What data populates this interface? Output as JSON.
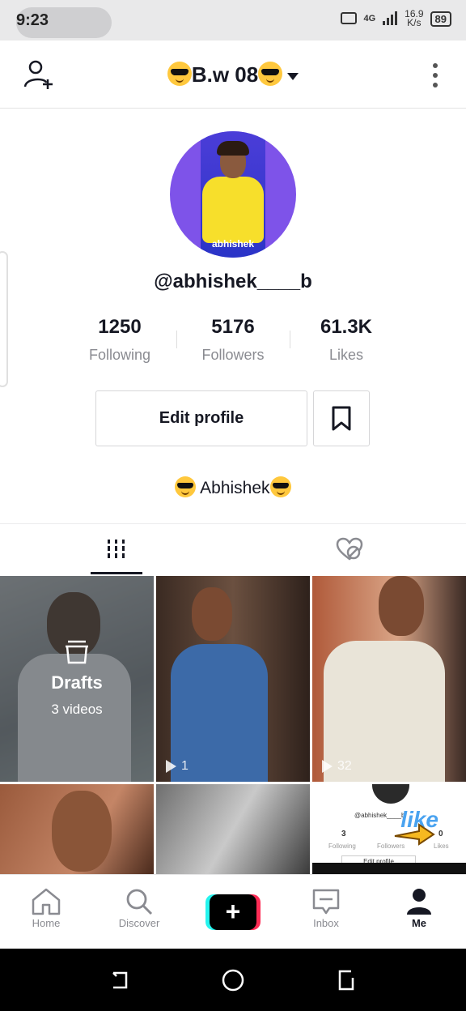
{
  "status_bar": {
    "time": "9:23",
    "network": "4G",
    "speed": "16.9",
    "speed_unit": "K/s",
    "battery": "89"
  },
  "header": {
    "title": "B.w 08"
  },
  "profile": {
    "avatar_caption": "abhishek",
    "handle": "@abhishek____b",
    "stats": [
      {
        "value": "1250",
        "label": "Following"
      },
      {
        "value": "5176",
        "label": "Followers"
      },
      {
        "value": "61.3K",
        "label": "Likes"
      }
    ],
    "edit_label": "Edit profile",
    "bio": "Abhishek"
  },
  "grid": {
    "drafts_title": "Drafts",
    "drafts_count": "3 videos",
    "views": [
      "1",
      "32"
    ],
    "thumb6": {
      "handle": "@abhishek____b",
      "following_num": "3",
      "following_label": "Following",
      "followers_label": "Followers",
      "likes_num": "0",
      "likes_label": "Likes",
      "edit_label": "Edit profile",
      "overlay": "like"
    }
  },
  "bottom_nav": [
    {
      "label": "Home",
      "icon": "home-icon"
    },
    {
      "label": "Discover",
      "icon": "search-icon"
    },
    {
      "label": "",
      "icon": "plus-icon"
    },
    {
      "label": "Inbox",
      "icon": "inbox-icon"
    },
    {
      "label": "Me",
      "icon": "profile-icon"
    }
  ],
  "colors": {
    "accent_cyan": "#25f4ee",
    "accent_red": "#fe2c55",
    "text": "#161823",
    "muted": "#8a8b91"
  }
}
